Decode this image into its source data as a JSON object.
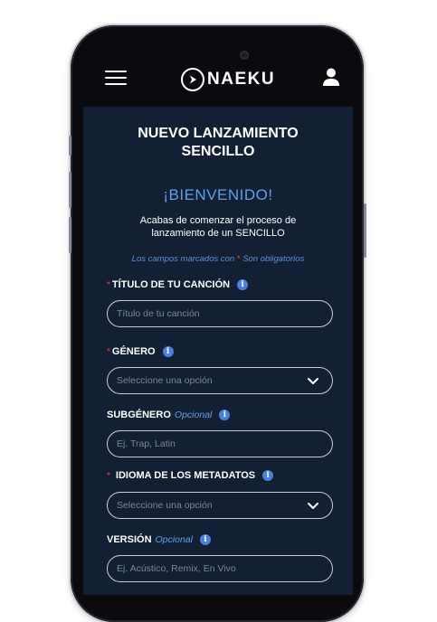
{
  "header": {
    "menu_icon": "hamburger-menu-icon",
    "logo_text": "NAEKU",
    "user_icon": "user-icon"
  },
  "page": {
    "title_line1": "NUEVO LANZAMIENTO",
    "title_line2": "SENCILLO",
    "welcome": "¡BIENVENIDO!",
    "intro": "Acabas de comenzar el proceso de lanzamiento de un SENCILLO",
    "required_note_prefix": "Los campos marcados con",
    "required_star": "*",
    "required_note_suffix": "Son obligatorios"
  },
  "form": {
    "title_field": {
      "label": "TÍTULO DE TU CANCIÓN",
      "required": "*",
      "placeholder": "Título de tu canción"
    },
    "genre_field": {
      "label": "GÉNERO",
      "required": "*",
      "placeholder": "Seleccione una opción"
    },
    "subgenre_field": {
      "label": "SUBGÉNERO",
      "optional": "Opcional",
      "placeholder": "Ej. Trap, Latin"
    },
    "language_field": {
      "label": "IDIOMA DE LOS METADATOS",
      "required": "*",
      "placeholder": "Seleccione una opción"
    },
    "version_field": {
      "label": "VERSIÓN",
      "optional": "Opcional",
      "placeholder": "Ej. Acústico, Remix, En Vivo"
    }
  },
  "colors": {
    "screen_bg": "#132033",
    "accent_blue": "#5aa1e8",
    "required_red": "#e0403f",
    "info_blue": "#4a80e0"
  }
}
